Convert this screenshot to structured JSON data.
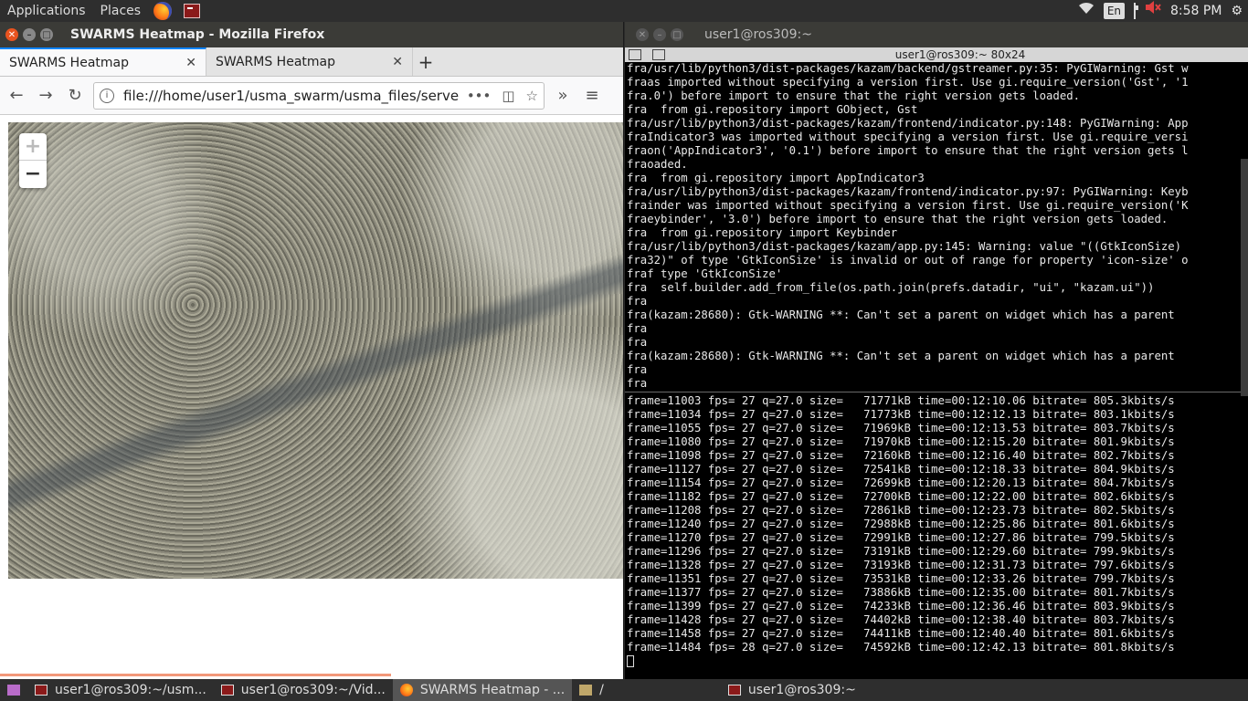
{
  "topbar": {
    "applications": "Applications",
    "places": "Places",
    "lang": "En",
    "time": "8:58 PM"
  },
  "firefox": {
    "window_title": "SWARMS Heatmap - Mozilla Firefox",
    "tabs": [
      {
        "label": "SWARMS Heatmap"
      },
      {
        "label": "SWARMS Heatmap"
      }
    ],
    "url": "file:///home/user1/usma_swarm/usma_files/serve",
    "map": {
      "zoom_in": "+",
      "zoom_out": "−"
    }
  },
  "terminal": {
    "window_title": "user1@ros309:~",
    "bar_title": "user1@ros309:~ 80x24",
    "pane1_lines": [
      "fra/usr/lib/python3/dist-packages/kazam/backend/gstreamer.py:35: PyGIWarning: Gst w",
      "fraas imported without specifying a version first. Use gi.require_version('Gst', '1",
      "fra.0') before import to ensure that the right version gets loaded.",
      "fra  from gi.repository import GObject, Gst",
      "fra/usr/lib/python3/dist-packages/kazam/frontend/indicator.py:148: PyGIWarning: App",
      "fraIndicator3 was imported without specifying a version first. Use gi.require_versi",
      "fraon('AppIndicator3', '0.1') before import to ensure that the right version gets l",
      "fraoaded.",
      "fra  from gi.repository import AppIndicator3",
      "fra/usr/lib/python3/dist-packages/kazam/frontend/indicator.py:97: PyGIWarning: Keyb",
      "frainder was imported without specifying a version first. Use gi.require_version('K",
      "fraeybinder', '3.0') before import to ensure that the right version gets loaded.",
      "fra  from gi.repository import Keybinder",
      "fra/usr/lib/python3/dist-packages/kazam/app.py:145: Warning: value \"((GtkIconSize)",
      "fra32)\" of type 'GtkIconSize' is invalid or out of range for property 'icon-size' o",
      "fraf type 'GtkIconSize'",
      "fra  self.builder.add_from_file(os.path.join(prefs.datadir, \"ui\", \"kazam.ui\"))",
      "fra",
      "fra(kazam:28680): Gtk-WARNING **: Can't set a parent on widget which has a parent",
      "fra",
      "fra",
      "fra(kazam:28680): Gtk-WARNING **: Can't set a parent on widget which has a parent",
      "fra",
      "fra"
    ],
    "pane2_lines": [
      "frame=11003 fps= 27 q=27.0 size=   71771kB time=00:12:10.06 bitrate= 805.3kbits/s",
      "frame=11034 fps= 27 q=27.0 size=   71773kB time=00:12:12.13 bitrate= 803.1kbits/s",
      "frame=11055 fps= 27 q=27.0 size=   71969kB time=00:12:13.53 bitrate= 803.7kbits/s",
      "frame=11080 fps= 27 q=27.0 size=   71970kB time=00:12:15.20 bitrate= 801.9kbits/s",
      "frame=11098 fps= 27 q=27.0 size=   72160kB time=00:12:16.40 bitrate= 802.7kbits/s",
      "frame=11127 fps= 27 q=27.0 size=   72541kB time=00:12:18.33 bitrate= 804.9kbits/s",
      "frame=11154 fps= 27 q=27.0 size=   72699kB time=00:12:20.13 bitrate= 804.7kbits/s",
      "frame=11182 fps= 27 q=27.0 size=   72700kB time=00:12:22.00 bitrate= 802.6kbits/s",
      "frame=11208 fps= 27 q=27.0 size=   72861kB time=00:12:23.73 bitrate= 802.5kbits/s",
      "frame=11240 fps= 27 q=27.0 size=   72988kB time=00:12:25.86 bitrate= 801.6kbits/s",
      "frame=11270 fps= 27 q=27.0 size=   72991kB time=00:12:27.86 bitrate= 799.5kbits/s",
      "frame=11296 fps= 27 q=27.0 size=   73191kB time=00:12:29.60 bitrate= 799.9kbits/s",
      "frame=11328 fps= 27 q=27.0 size=   73193kB time=00:12:31.73 bitrate= 797.6kbits/s",
      "frame=11351 fps= 27 q=27.0 size=   73531kB time=00:12:33.26 bitrate= 799.7kbits/s",
      "frame=11377 fps= 27 q=27.0 size=   73886kB time=00:12:35.00 bitrate= 801.7kbits/s",
      "frame=11399 fps= 27 q=27.0 size=   74233kB time=00:12:36.46 bitrate= 803.9kbits/s",
      "frame=11428 fps= 27 q=27.0 size=   74402kB time=00:12:38.40 bitrate= 803.7kbits/s",
      "frame=11458 fps= 27 q=27.0 size=   74411kB time=00:12:40.40 bitrate= 801.6kbits/s",
      "frame=11484 fps= 28 q=27.0 size=   74592kB time=00:12:42.13 bitrate= 801.8kbits/s"
    ]
  },
  "taskbar": {
    "items": [
      {
        "label": "user1@ros309:~/usm..."
      },
      {
        "label": "user1@ros309:~/Vid..."
      },
      {
        "label": "SWARMS Heatmap - ..."
      },
      {
        "label": "/"
      },
      {
        "label": "user1@ros309:~"
      }
    ]
  }
}
